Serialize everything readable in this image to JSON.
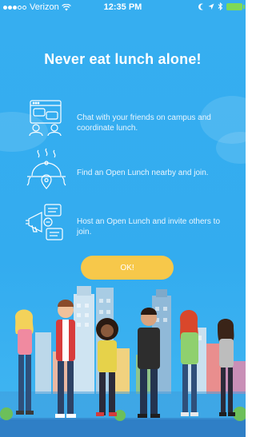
{
  "status_bar": {
    "carrier": "Verizon",
    "time": "12:35 PM",
    "icons": [
      "signal-dots-icon",
      "wifi-icon",
      "moon-icon",
      "location-arrow-icon",
      "bluetooth-icon",
      "battery-icon"
    ],
    "battery_color": "#7ed957"
  },
  "onboarding": {
    "title": "Never eat lunch alone!",
    "features": [
      {
        "icon": "chat-browser-icon",
        "text": "Chat with your friends on campus and coordinate lunch."
      },
      {
        "icon": "serving-dish-location-icon",
        "text": "Find an Open Lunch nearby and join."
      },
      {
        "icon": "megaphone-chat-icon",
        "text": "Host an Open Lunch and invite others to join."
      }
    ],
    "ok_label": "OK!"
  },
  "colors": {
    "background": "#36aef0",
    "button": "#f7c84a",
    "text": "#ffffff"
  },
  "illustration": {
    "description_icon": "people-city-illustration"
  }
}
